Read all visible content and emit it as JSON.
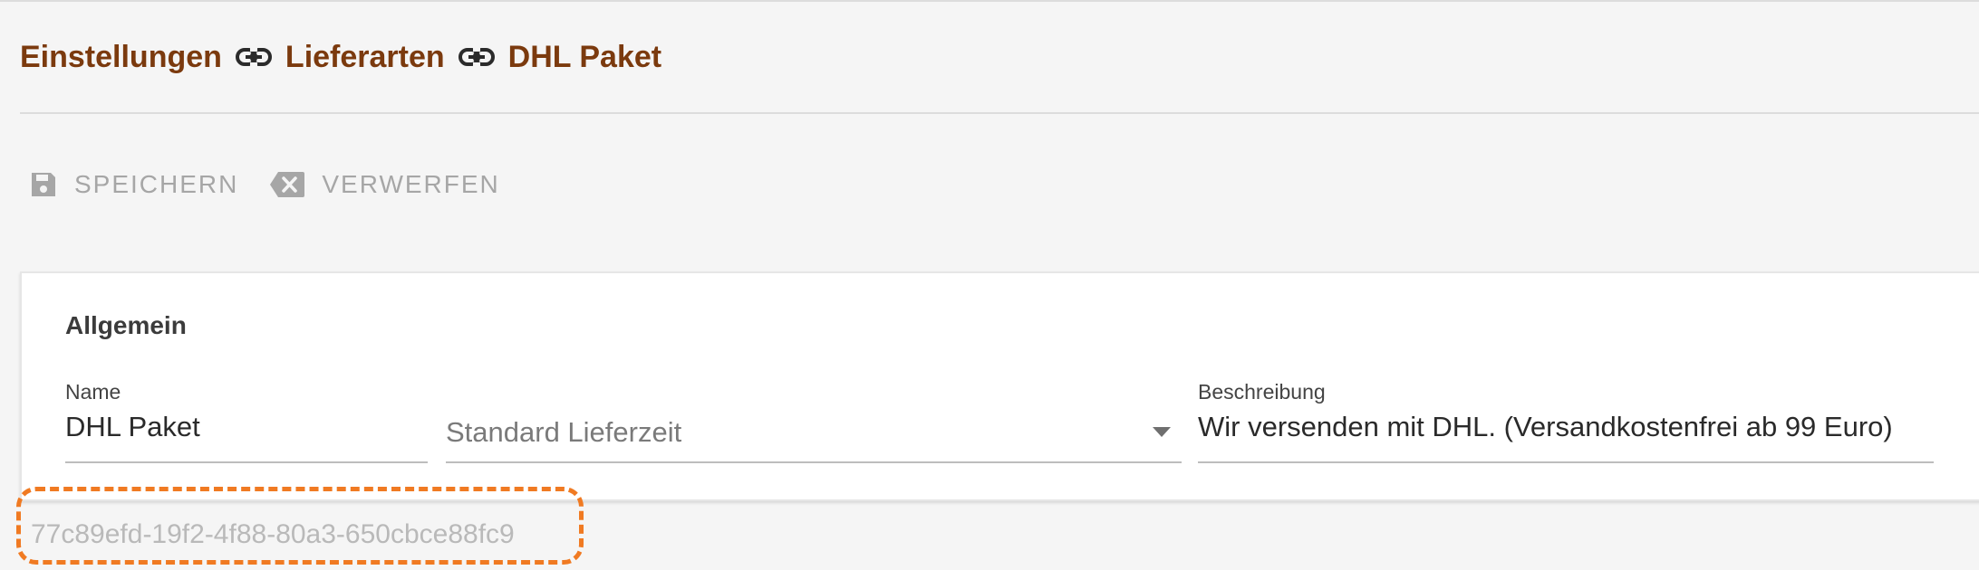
{
  "breadcrumb": {
    "items": [
      "Einstellungen",
      "Lieferarten",
      "DHL Paket"
    ],
    "separator_icon": "link-icon"
  },
  "toolbar": {
    "save_label": "SPEICHERN",
    "save_icon": "floppy-disk-icon",
    "discard_label": "VERWERFEN",
    "discard_icon": "backspace-icon"
  },
  "card": {
    "section_title": "Allgemein",
    "name": {
      "label": "Name",
      "value": "DHL Paket"
    },
    "delivery_time": {
      "placeholder": "Standard Lieferzeit"
    },
    "description": {
      "label": "Beschreibung",
      "value": "Wir versenden mit DHL. (Versandkostenfrei ab 99 Euro)"
    }
  },
  "record_id": "77c89efd-19f2-4f88-80a3-650cbce88fc9",
  "colors": {
    "accent": "#7b3a0e",
    "toolbar_text": "#a6a6a6",
    "highlight": "#f07a22",
    "background": "#f5f5f5"
  }
}
